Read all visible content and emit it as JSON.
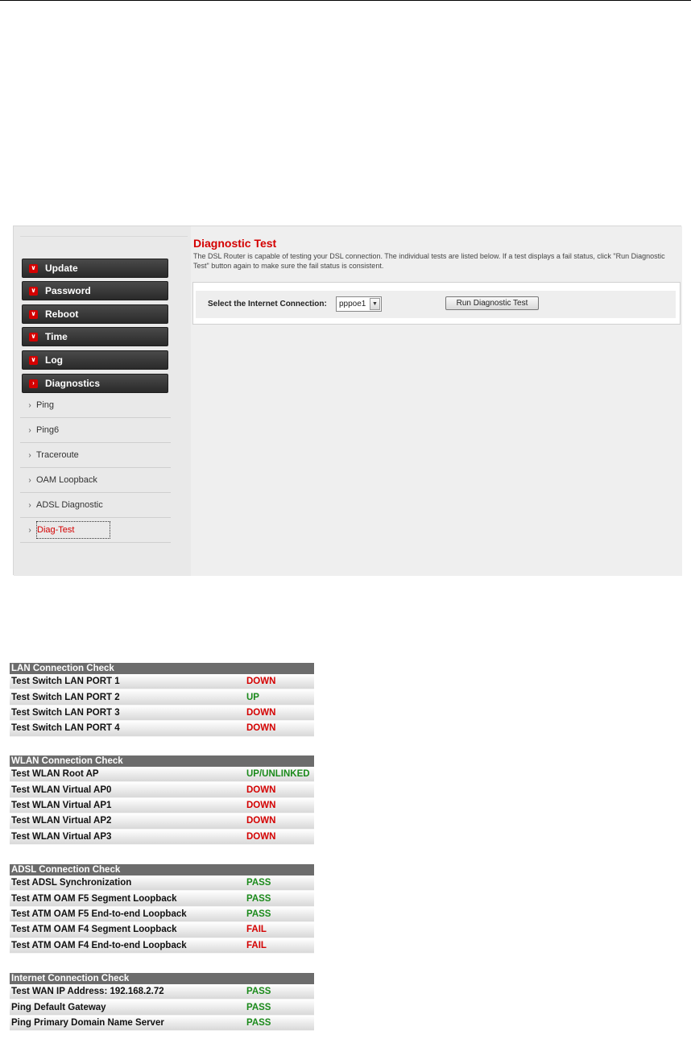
{
  "sidebar": {
    "menu": [
      {
        "label": "Update"
      },
      {
        "label": "Password"
      },
      {
        "label": "Reboot"
      },
      {
        "label": "Time"
      },
      {
        "label": "Log"
      },
      {
        "label": "Diagnostics"
      }
    ],
    "submenu": [
      {
        "label": "Ping"
      },
      {
        "label": "Ping6"
      },
      {
        "label": "Traceroute"
      },
      {
        "label": "OAM Loopback"
      },
      {
        "label": "ADSL Diagnostic"
      },
      {
        "label": "Diag-Test"
      }
    ]
  },
  "content": {
    "title": "Diagnostic Test",
    "description": "The DSL Router is capable of testing your DSL connection. The individual tests are listed below. If a test displays a fail status, click \"Run Diagnostic Test\" button again to make sure the fail status is consistent.",
    "select_label": "Select the Internet Connection:",
    "select_value": "pppoe1",
    "run_button": "Run Diagnostic Test"
  },
  "checks": [
    {
      "title": "LAN Connection Check",
      "rows": [
        {
          "label": "Test Switch LAN PORT 1",
          "status": "DOWN"
        },
        {
          "label": "Test Switch LAN PORT 2",
          "status": "UP"
        },
        {
          "label": "Test Switch LAN PORT 3",
          "status": "DOWN"
        },
        {
          "label": "Test Switch LAN PORT 4",
          "status": "DOWN"
        }
      ]
    },
    {
      "title": "WLAN Connection Check",
      "rows": [
        {
          "label": "Test WLAN Root AP",
          "status": "UP/UNLINKED"
        },
        {
          "label": "Test WLAN Virtual AP0",
          "status": "DOWN"
        },
        {
          "label": "Test WLAN Virtual AP1",
          "status": "DOWN"
        },
        {
          "label": "Test WLAN Virtual AP2",
          "status": "DOWN"
        },
        {
          "label": "Test WLAN Virtual AP3",
          "status": "DOWN"
        }
      ]
    },
    {
      "title": "ADSL Connection Check",
      "rows": [
        {
          "label": "Test ADSL Synchronization",
          "status": "PASS"
        },
        {
          "label": "Test ATM OAM F5 Segment Loopback",
          "status": "PASS"
        },
        {
          "label": "Test ATM OAM F5 End-to-end Loopback",
          "status": "PASS"
        },
        {
          "label": "Test ATM OAM F4 Segment Loopback",
          "status": "FAIL"
        },
        {
          "label": "Test ATM OAM F4 End-to-end Loopback",
          "status": "FAIL"
        }
      ]
    },
    {
      "title": "Internet Connection Check",
      "rows": [
        {
          "label": "Test WAN IP Address: 192.168.2.72",
          "status": "PASS"
        },
        {
          "label": "Ping Default Gateway",
          "status": "PASS"
        },
        {
          "label": "Ping Primary Domain Name Server",
          "status": "PASS"
        }
      ]
    }
  ],
  "colors": {
    "accent_red": "#d40000",
    "status_good": "#1b8a1b",
    "status_bad": "#d40000"
  }
}
